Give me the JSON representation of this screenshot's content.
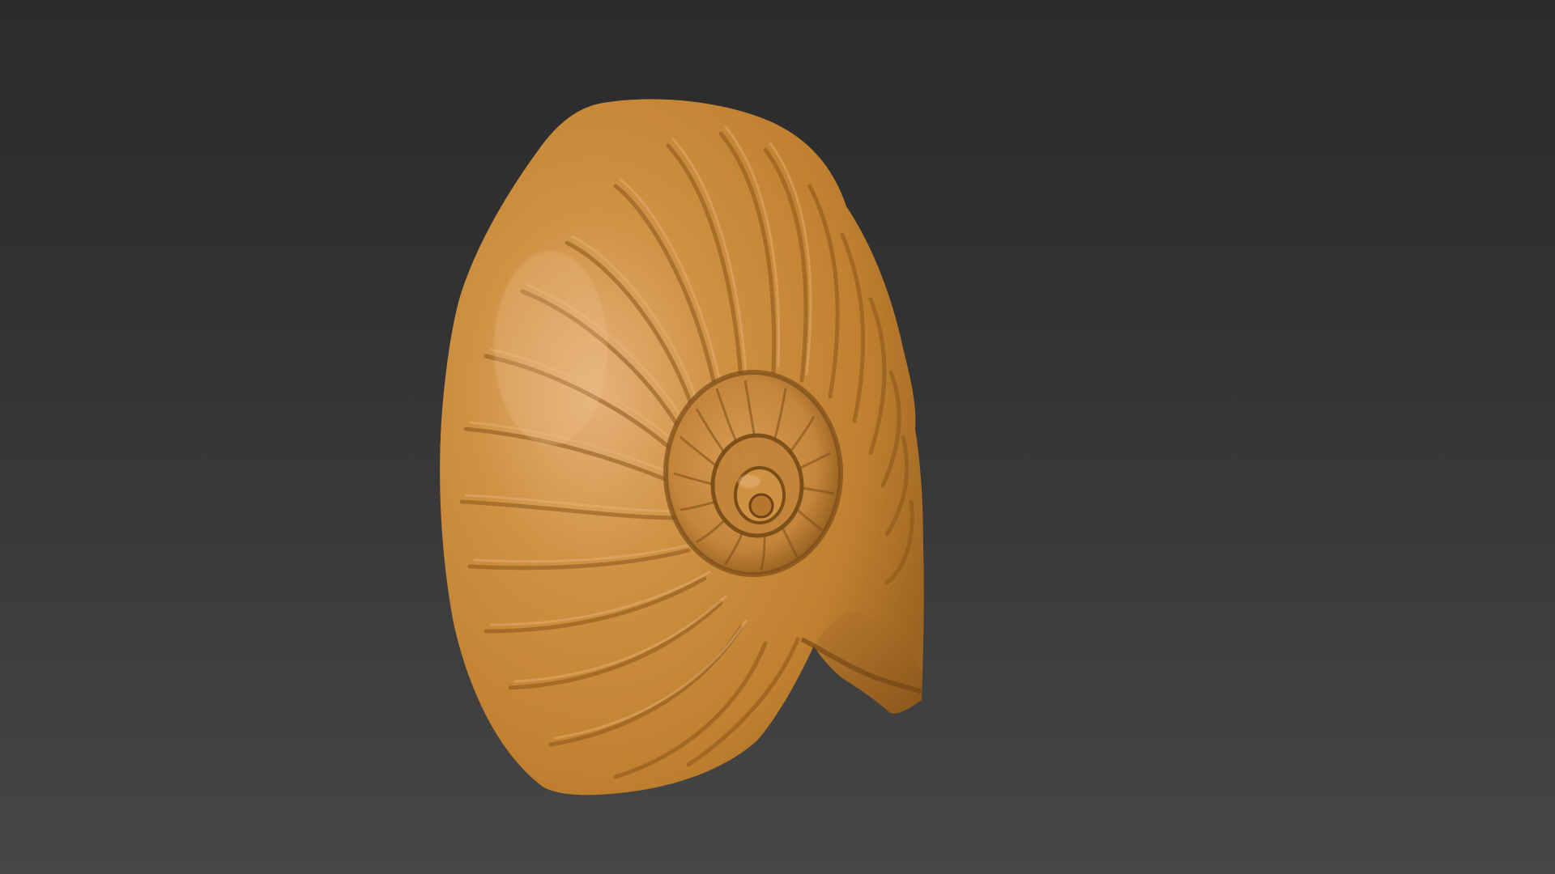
{
  "scene": {
    "subject": "ammonite-shell-sculpt",
    "colors": {
      "background_top": "#2b2b2b",
      "background_bottom": "#464646",
      "material_base": "#c98a3d",
      "material_highlight": "#e2ad72",
      "material_shadow": "#7a4d18"
    }
  }
}
